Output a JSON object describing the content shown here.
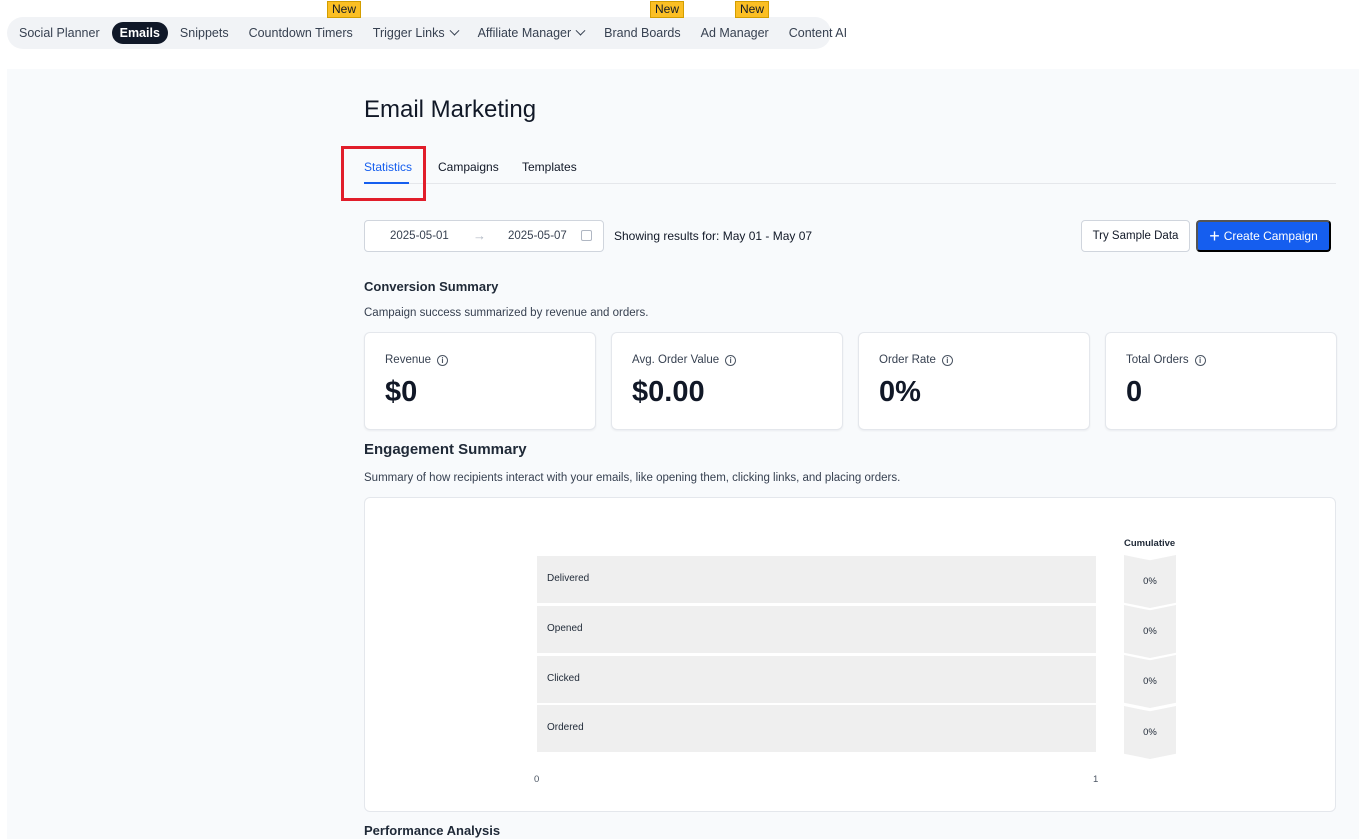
{
  "nav": {
    "items": [
      {
        "label": "Social Planner",
        "active": false,
        "dropdown": false,
        "badge": ""
      },
      {
        "label": "Emails",
        "active": true,
        "dropdown": false,
        "badge": ""
      },
      {
        "label": "Snippets",
        "active": false,
        "dropdown": false,
        "badge": ""
      },
      {
        "label": "Countdown Timers",
        "active": false,
        "dropdown": false,
        "badge": "New"
      },
      {
        "label": "Trigger Links",
        "active": false,
        "dropdown": true,
        "badge": ""
      },
      {
        "label": "Affiliate Manager",
        "active": false,
        "dropdown": true,
        "badge": ""
      },
      {
        "label": "Brand Boards",
        "active": false,
        "dropdown": false,
        "badge": "New"
      },
      {
        "label": "Ad Manager",
        "active": false,
        "dropdown": false,
        "badge": "New"
      },
      {
        "label": "Content AI",
        "active": false,
        "dropdown": false,
        "badge": ""
      }
    ]
  },
  "page": {
    "title": "Email Marketing",
    "tabs": [
      {
        "label": "Statistics",
        "active": true
      },
      {
        "label": "Campaigns",
        "active": false
      },
      {
        "label": "Templates",
        "active": false
      }
    ]
  },
  "filters": {
    "start_date": "2025-05-01",
    "end_date": "2025-05-07",
    "arrow": "→",
    "showing": "Showing results for: May 01 - May 07"
  },
  "actions": {
    "sample_label": "Try Sample Data",
    "create_label": "Create Campaign",
    "create_icon": "+"
  },
  "conversion": {
    "heading": "Conversion Summary",
    "subtitle": "Campaign success summarized by revenue and orders.",
    "cards": [
      {
        "label": "Revenue",
        "value": "$0"
      },
      {
        "label": "Avg. Order Value",
        "value": "$0.00"
      },
      {
        "label": "Order Rate",
        "value": "0%"
      },
      {
        "label": "Total Orders",
        "value": "0"
      }
    ]
  },
  "engagement": {
    "heading": "Engagement Summary",
    "subtitle": "Summary of how recipients interact with your emails, like opening them, clicking links, and placing orders.",
    "cumulative_title": "Cumulative",
    "stages": [
      {
        "label": "Delivered",
        "cumulative": "0%"
      },
      {
        "label": "Opened",
        "cumulative": "0%"
      },
      {
        "label": "Clicked",
        "cumulative": "0%"
      },
      {
        "label": "Ordered",
        "cumulative": "0%"
      }
    ],
    "axis_min": "0",
    "axis_max": "1"
  },
  "performance": {
    "heading": "Performance Analysis"
  },
  "colors": {
    "accent": "#155eef",
    "badge": "#fbbf24",
    "highlight": "#e11d2a",
    "active_nav": "#101828"
  }
}
